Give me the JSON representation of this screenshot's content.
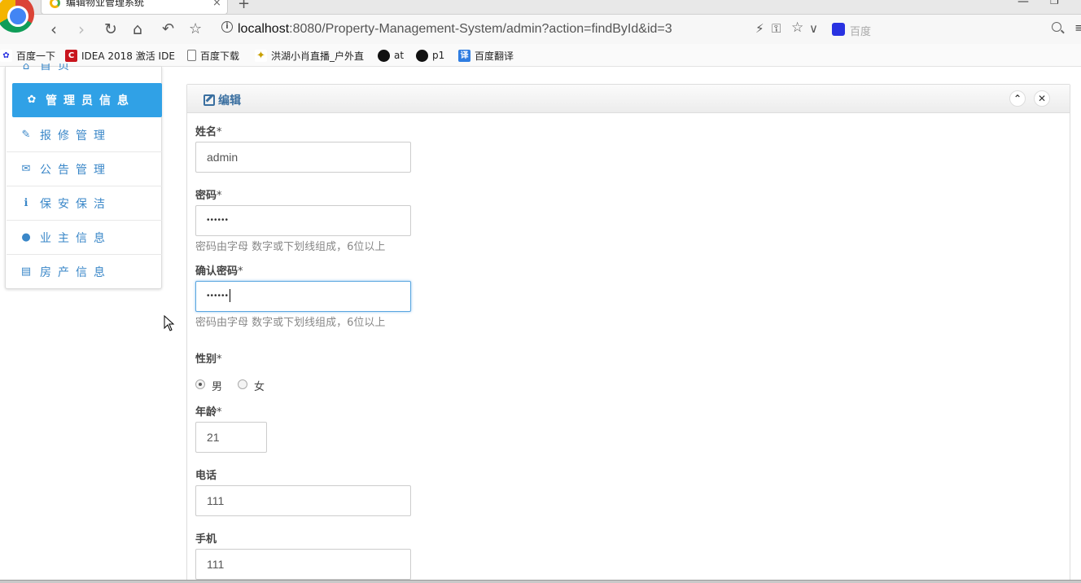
{
  "browser": {
    "tab_title": "编辑物业管理系统",
    "tab_close": "×",
    "new_tab": "+",
    "window_min": "—",
    "window_max": "❐",
    "url_host": "localhost",
    "url_path": ":8080/Property-Management-System/admin?action=findById&id=3",
    "search_placeholder": "百度",
    "info_icon": "i",
    "icons": [
      "back-icon",
      "forward-icon",
      "reload-icon",
      "home-icon",
      "undo-icon",
      "star-icon",
      "lightning-icon",
      "key-icon",
      "chevron-down-icon",
      "search-icon",
      "menu-icon"
    ]
  },
  "bookmarks": [
    {
      "label": "百度一下",
      "icon": "baidu-paw-icon",
      "color": "#2932e1",
      "glyph": "✿"
    },
    {
      "label": "IDEA 2018 激活 IDE",
      "icon": "csdn-icon",
      "color": "#c9151e",
      "glyph": "C"
    },
    {
      "label": "百度下载",
      "icon": "page-icon",
      "color": "#ffffff",
      "glyph": ""
    },
    {
      "label": "洪湖小肖直播_户外直",
      "icon": "bee-icon",
      "color": "#c8a000",
      "glyph": "✦"
    },
    {
      "label": "at",
      "icon": "github-icon",
      "color": "#111111",
      "glyph": "●"
    },
    {
      "label": "p1",
      "icon": "github-icon",
      "color": "#111111",
      "glyph": "●"
    },
    {
      "label": "百度翻译",
      "icon": "translate-icon",
      "color": "#2f7de1",
      "glyph": "译"
    }
  ],
  "sidebar": {
    "items": [
      {
        "label": "首页",
        "icon": "home-icon",
        "glyph": "⌂"
      },
      {
        "label": "管理员信息",
        "icon": "gear-icon",
        "glyph": "✿",
        "active": true
      },
      {
        "label": "报修管理",
        "icon": "wrench-icon",
        "glyph": "✎"
      },
      {
        "label": "公告管理",
        "icon": "envelope-icon",
        "glyph": "✉"
      },
      {
        "label": "保安保洁",
        "icon": "info-icon",
        "glyph": "ℹ"
      },
      {
        "label": "业主信息",
        "icon": "user-icon",
        "glyph": "●"
      },
      {
        "label": "房产信息",
        "icon": "list-icon",
        "glyph": "▤"
      }
    ]
  },
  "panel": {
    "title": "编辑",
    "collapse_glyph": "⌃",
    "close_glyph": "✕"
  },
  "form": {
    "name_label": "姓名",
    "name_value": "admin",
    "password_label": "密码",
    "password_value": "••••••",
    "password_hint": "密码由字母 数字或下划线组成，6位以上",
    "confirm_label": "确认密码",
    "confirm_value": "••••••",
    "confirm_hint": "密码由字母 数字或下划线组成，6位以上",
    "gender_label": "性别",
    "gender_male": "男",
    "gender_female": "女",
    "gender_selected": "男",
    "age_label": "年龄",
    "age_value": "21",
    "phone_label": "电话",
    "phone_value": "111",
    "mobile_label": "手机",
    "mobile_value": "111",
    "required_mark": "*"
  }
}
